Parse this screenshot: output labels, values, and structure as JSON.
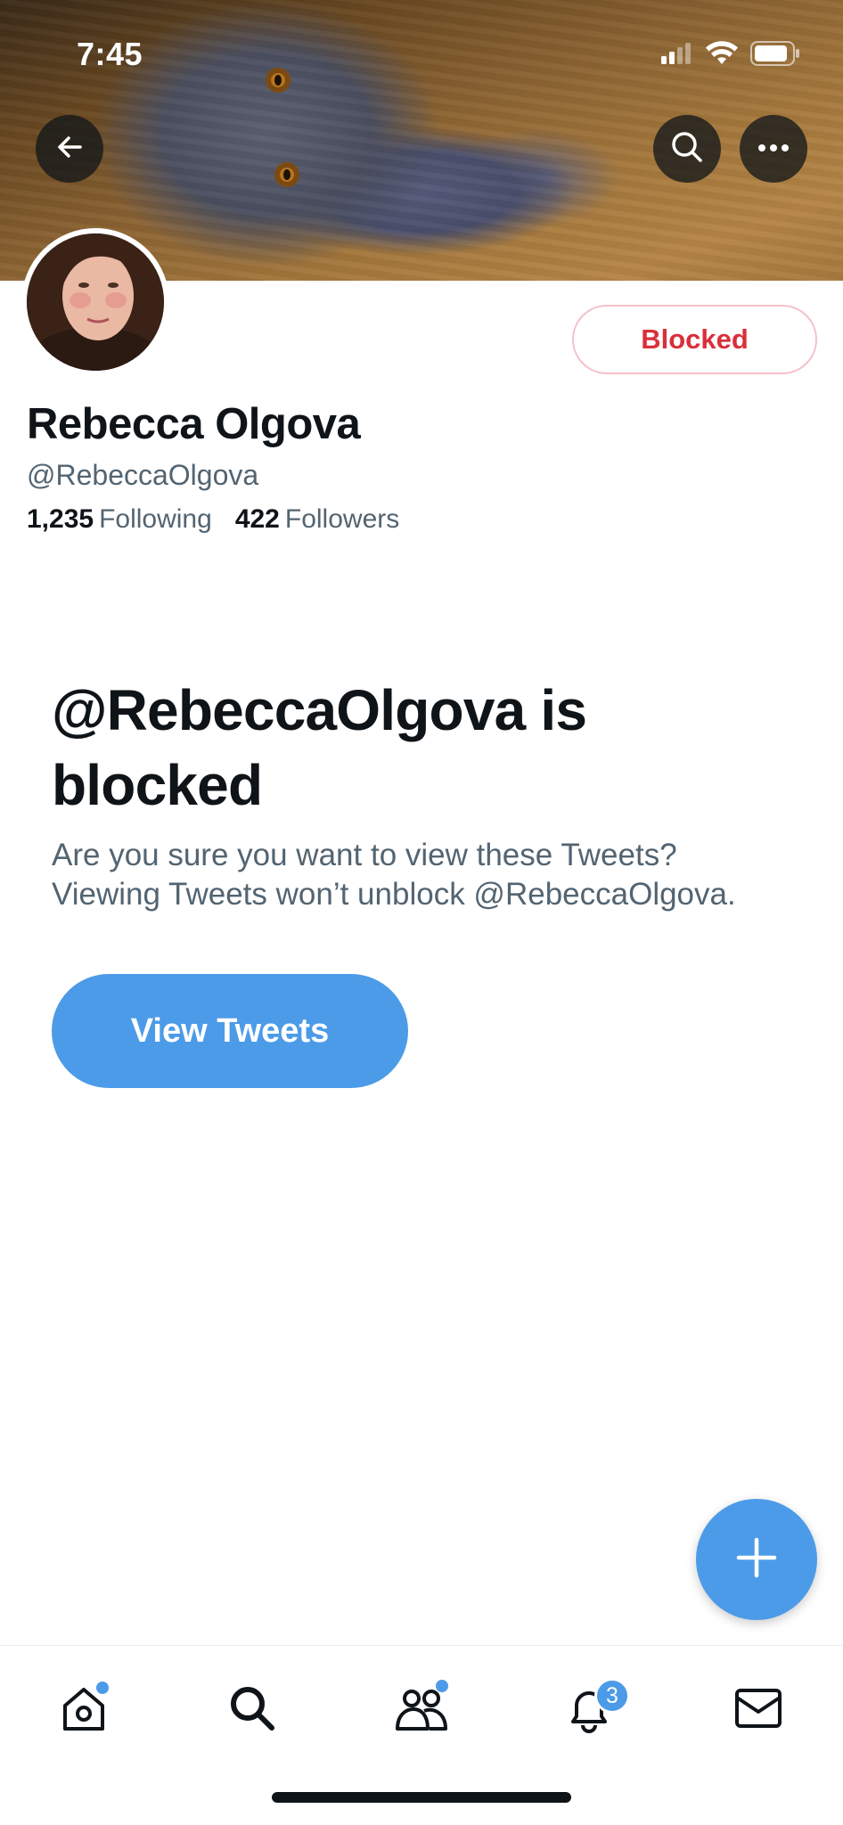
{
  "status_bar": {
    "time": "7:45"
  },
  "profile": {
    "name": "Rebecca Olgova",
    "handle": "@RebeccaOlgova",
    "following_count": "1,235",
    "following_label": "Following",
    "followers_count": "422",
    "followers_label": "Followers",
    "blocked_button_label": "Blocked"
  },
  "blocked_notice": {
    "title": "@RebeccaOlgova is blocked",
    "description_line1": "Are you sure you want to view these Tweets?",
    "description_line2": "Viewing Tweets won’t unblock @RebeccaOlgova.",
    "view_button_label": "View Tweets"
  },
  "tab_bar": {
    "notifications_badge": "3",
    "items": [
      "home-icon",
      "search-icon",
      "communities-icon",
      "bell-icon",
      "mail-icon"
    ]
  },
  "colors": {
    "accent": "#4c9be8",
    "blocked_red": "#d9303a",
    "secondary_text": "#536471"
  }
}
